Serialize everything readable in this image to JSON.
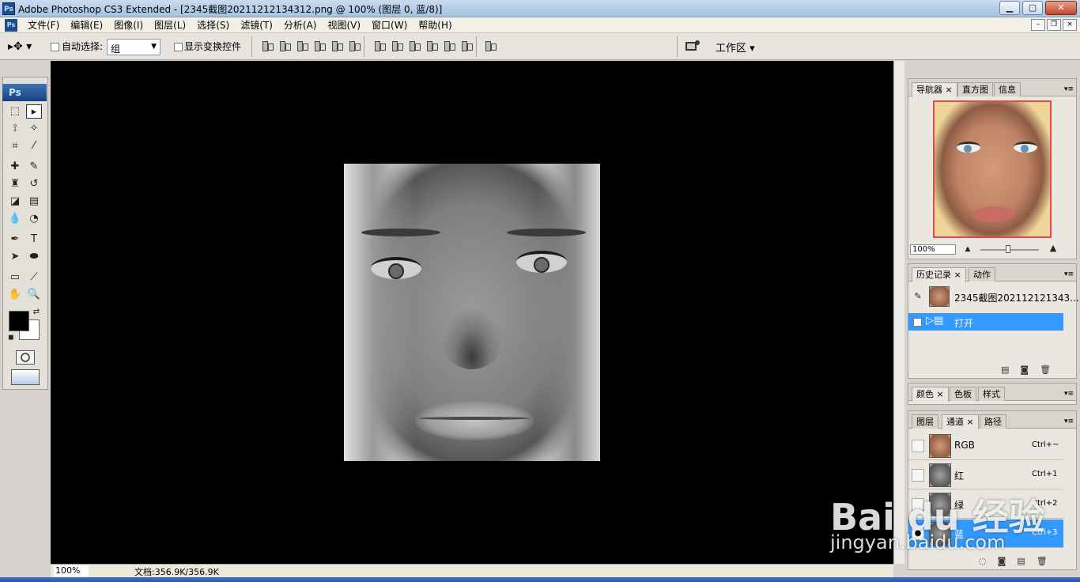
{
  "window": {
    "app_icon": "Ps",
    "title": "Adobe Photoshop CS3 Extended - [2345截图20211212134312.png @ 100% (图层 0, 蓝/8)]",
    "minimize": "▁",
    "maximize": "▢",
    "close": "✕"
  },
  "menubar": {
    "items": [
      "文件(F)",
      "编辑(E)",
      "图像(I)",
      "图层(L)",
      "选择(S)",
      "滤镜(T)",
      "分析(A)",
      "视图(V)",
      "窗口(W)",
      "帮助(H)"
    ],
    "doc_minimize": "–",
    "doc_restore": "❐",
    "doc_close": "×"
  },
  "options": {
    "tool_glyph": "▸✥ ▾",
    "auto_select_label": "自动选择:",
    "auto_select_value": "组",
    "show_transform_label": "显示变换控件",
    "workspace_label": "工作区 ▾"
  },
  "toolbox": {
    "header": "Ps"
  },
  "status": {
    "zoom": "100%",
    "doc_info": "文档:356.9K/356.9K"
  },
  "navigator": {
    "tabs": [
      "导航器",
      "直方图",
      "信息"
    ],
    "zoom": "100%"
  },
  "history": {
    "tabs": [
      "历史记录",
      "动作"
    ],
    "snapshot_name": "2345截图202112121343...",
    "step": "打开"
  },
  "color": {
    "tabs": [
      "颜色",
      "色板",
      "样式"
    ]
  },
  "channels": {
    "tabs": [
      "图层",
      "通道",
      "路径"
    ],
    "rows": [
      {
        "name": "RGB",
        "shortcut": "Ctrl+~"
      },
      {
        "name": "红",
        "shortcut": "Ctrl+1"
      },
      {
        "name": "绿",
        "shortcut": "Ctrl+2"
      },
      {
        "name": "蓝",
        "shortcut": "Ctrl+3"
      }
    ]
  },
  "watermark": {
    "brand": "Bai du 经验",
    "url": "jingyan.baidu.com"
  },
  "colors": {
    "selection_blue": "#3399ff",
    "canvas_bg": "#000000",
    "ps_header": "#16437f"
  }
}
